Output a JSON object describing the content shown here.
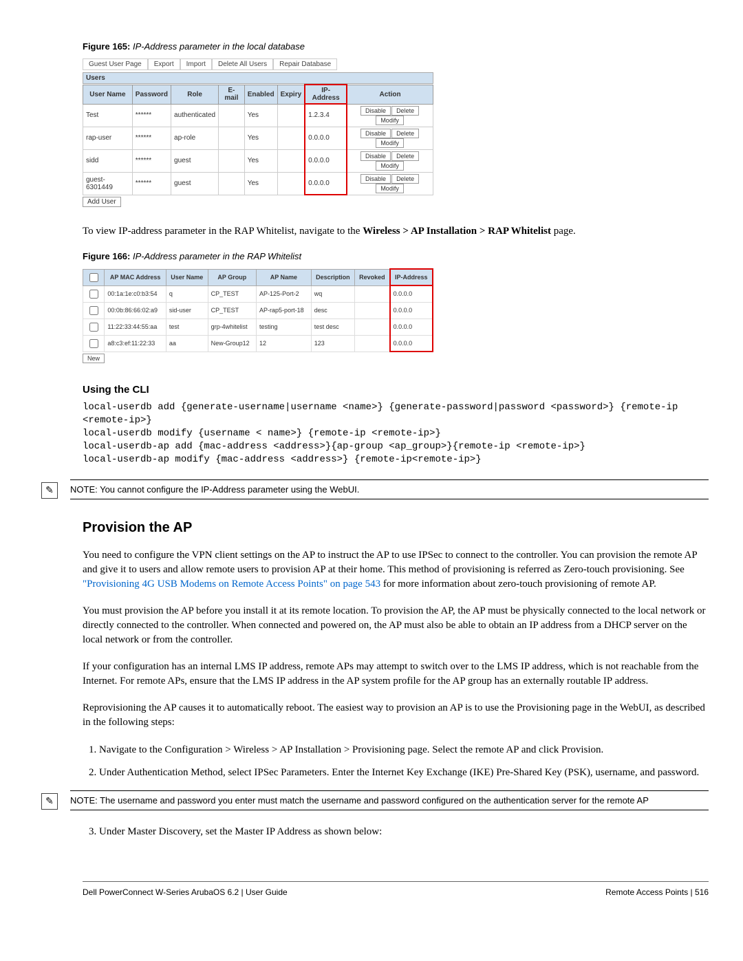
{
  "fig165": {
    "caption_label": "Figure 165:",
    "caption_text": " IP-Address parameter in the local database",
    "tabs": [
      "Guest User Page",
      "Export",
      "Import",
      "Delete All Users",
      "Repair Database"
    ],
    "users_label": "Users",
    "headers": [
      "User Name",
      "Password",
      "Role",
      "E-mail",
      "Enabled",
      "Expiry",
      "IP-Address",
      "Action"
    ],
    "rows": [
      {
        "user": "Test",
        "pass": "******",
        "role": "authenticated",
        "email": "",
        "enabled": "Yes",
        "expiry": "",
        "ip": "1.2.3.4"
      },
      {
        "user": "rap-user",
        "pass": "******",
        "role": "ap-role",
        "email": "",
        "enabled": "Yes",
        "expiry": "",
        "ip": "0.0.0.0"
      },
      {
        "user": "sidd",
        "pass": "******",
        "role": "guest",
        "email": "",
        "enabled": "Yes",
        "expiry": "",
        "ip": "0.0.0.0"
      },
      {
        "user": "guest-6301449",
        "pass": "******",
        "role": "guest",
        "email": "",
        "enabled": "Yes",
        "expiry": "",
        "ip": "0.0.0.0"
      }
    ],
    "btn_disable": "Disable",
    "btn_delete": "Delete",
    "btn_modify": "Modify",
    "add_user": "Add User"
  },
  "para1_a": "To view IP-address parameter in the RAP Whitelist, navigate to the ",
  "para1_b": "Wireless > AP Installation > RAP Whitelist",
  "para1_c": " page.",
  "fig166": {
    "caption_label": "Figure 166:",
    "caption_text": " IP-Address parameter in the RAP Whitelist",
    "headers": [
      "",
      "AP MAC Address",
      "User Name",
      "AP Group",
      "AP Name",
      "Description",
      "Revoked",
      "IP-Address"
    ],
    "rows": [
      {
        "mac": "00:1a:1e:c0:b3:54",
        "user": "q",
        "group": "CP_TEST",
        "name": "AP-125-Port-2",
        "desc": "wq",
        "rev": "",
        "ip": "0.0.0.0"
      },
      {
        "mac": "00:0b:86:66:02:a9",
        "user": "sid-user",
        "group": "CP_TEST",
        "name": "AP-rap5-port-18",
        "desc": "desc",
        "rev": "",
        "ip": "0.0.0.0"
      },
      {
        "mac": "11:22:33:44:55:aa",
        "user": "test",
        "group": "grp-4whitelist",
        "name": "testing",
        "desc": "test desc",
        "rev": "",
        "ip": "0.0.0.0"
      },
      {
        "mac": "a8:c3:ef:11:22:33",
        "user": "aa",
        "group": "New-Group12",
        "name": "12",
        "desc": "123",
        "rev": "",
        "ip": "0.0.0.0"
      }
    ],
    "new_btn": "New"
  },
  "heading_cli": "Using the CLI",
  "cli_code": "local-userdb add {generate-username|username <name>} {generate-password|password <password>} {remote-ip <remote-ip>}\nlocal-userdb modify {username < name>} {remote-ip <remote-ip>}\nlocal-userdb-ap add {mac-address <address>}{ap-group <ap_group>}{remote-ip <remote-ip>}\nlocal-userdb-ap modify {mac-address <address>} {remote-ip<remote-ip>}",
  "note1": "NOTE: You cannot configure the IP-Address parameter using the WebUI.",
  "heading_provision": "Provision the AP",
  "prov_p1_a": "You need to configure the VPN client settings on the AP to instruct the AP to use IPSec to connect to the controller. You can provision the remote AP and give it to users and allow remote users to provision AP at their home. This method of provisioning is referred as Zero-touch provisioning. See ",
  "prov_p1_link": "\"Provisioning 4G USB Modems on Remote Access Points\" on page 543",
  "prov_p1_b": " for more information about zero-touch provisioning of remote AP.",
  "prov_p2": "You must provision the AP before you install it at its remote location. To provision the AP, the AP must be physically connected to the local network or directly connected to the controller. When connected and powered on, the AP must also be able to obtain an IP address from a DHCP server on the local network or from the controller.",
  "prov_p3": "If your configuration has an internal LMS IP address, remote APs may attempt to switch over to the LMS IP address, which is not reachable from the Internet. For remote APs, ensure that the LMS IP address in the AP system profile for the AP group has an externally routable IP address.",
  "prov_p4": "Reprovisioning the AP causes it to automatically reboot. The easiest way to provision an AP is to use the Provisioning page in the WebUI, as described in the following steps:",
  "step1_a": "Navigate to the ",
  "step1_b": "Configuration > Wireless > AP Installation > Provisioning",
  "step1_c": " page. Select the remote AP and click ",
  "step1_d": "Provision",
  "step1_e": ".",
  "step2": "Under Authentication Method, select IPSec Parameters. Enter the Internet Key Exchange (IKE) Pre-Shared Key (PSK), username, and password.",
  "note2": "NOTE: The username and password you enter must match the username and password configured on the authentication server for the remote AP",
  "step3": "Under Master Discovery, set the Master IP Address as shown below:",
  "footer_left": "Dell PowerConnect W-Series ArubaOS 6.2  |  User Guide",
  "footer_right": "Remote Access Points  |  516"
}
